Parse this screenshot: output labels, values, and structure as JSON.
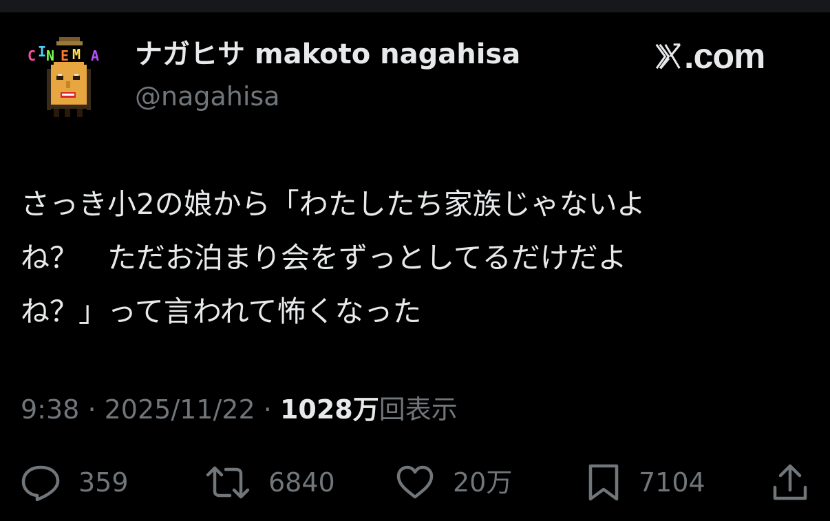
{
  "post": {
    "display_name": "ナガヒサ makoto nagahisa",
    "handle": "@nagahisa",
    "avatar_label": "CINEMA",
    "brand": "X.com",
    "brand_domain": ".com",
    "text_lines": [
      "さっき小2の娘から「わたしたち家族じゃないよ",
      "ね？　ただお泊まり会をずっとしてるだけだよ",
      "ね？」って言われて怖くなった"
    ],
    "time": "9:38",
    "date": "2025/11/22",
    "separator": "·",
    "views_count": "1028万",
    "views_label": "回表示"
  },
  "actions": {
    "reply_count": "359",
    "repost_count": "6840",
    "like_count": "20万",
    "bookmark_count": "7104"
  },
  "icons": {
    "reply": "reply-icon",
    "repost": "repost-icon",
    "like": "heart-icon",
    "bookmark": "bookmark-icon",
    "share": "share-icon",
    "brand": "x-logo-icon"
  },
  "colors": {
    "background": "#000000",
    "text_primary": "#e7e9ea",
    "text_secondary": "#71767b"
  }
}
